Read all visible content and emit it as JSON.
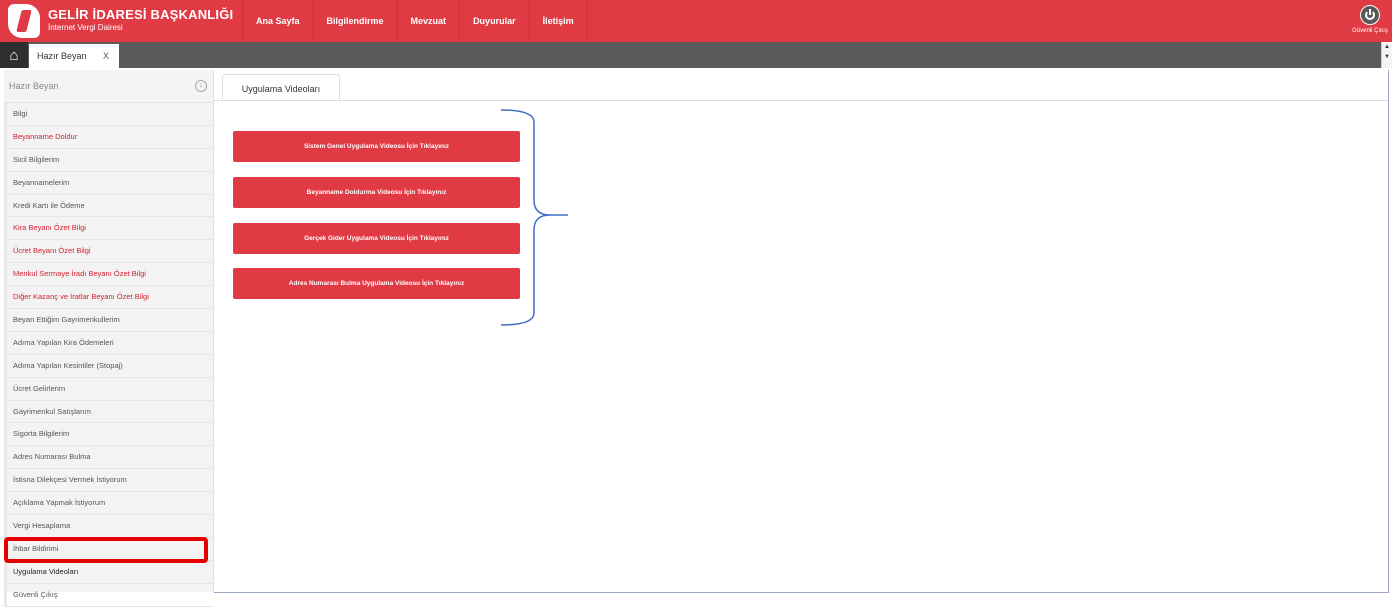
{
  "header": {
    "title": "GELİR İDARESİ BAŞKANLIĞI",
    "subtitle": "İnternet Vergi Dairesi",
    "nav": [
      "Ana Sayfa",
      "Bilgilendirme",
      "Mevzuat",
      "Duyurular",
      "İletişim"
    ],
    "logout_label": "Güvenli Çıkış"
  },
  "tabstrip": {
    "open_tab": "Hazır Beyan",
    "close_label": "X"
  },
  "sidebar": {
    "title": "Hazır Beyan",
    "items": [
      {
        "label": "Bilgi",
        "style": "normal"
      },
      {
        "label": "Beyanname Doldur",
        "style": "red"
      },
      {
        "label": "Sicil Bilgilerim",
        "style": "normal"
      },
      {
        "label": "Beyannamelerim",
        "style": "normal"
      },
      {
        "label": "Kredi Kartı ile Ödeme",
        "style": "normal"
      },
      {
        "label": "Kira Beyanı Özet Bilgi",
        "style": "red"
      },
      {
        "label": "Ücret Beyanı Özet Bilgi",
        "style": "red"
      },
      {
        "label": "Menkul Sermaye İradı Beyanı Özet Bilgi",
        "style": "red"
      },
      {
        "label": "Diğer Kazanç ve İratlar Beyanı Özet Bilgi",
        "style": "red"
      },
      {
        "label": "Beyan Ettiğim Gayrimenkullerim",
        "style": "normal"
      },
      {
        "label": "Adıma Yapılan Kira Ödemeleri",
        "style": "normal"
      },
      {
        "label": "Adıma Yapılan Kesintiler (Stopaj)",
        "style": "normal"
      },
      {
        "label": "Ücret Gelirlerim",
        "style": "normal"
      },
      {
        "label": "Gayrimenkul Satışlarım",
        "style": "normal"
      },
      {
        "label": "Sigorta Bilgilerim",
        "style": "normal"
      },
      {
        "label": "Adres Numarası Bulma",
        "style": "normal"
      },
      {
        "label": "İstisna Dilekçesi Vermek İstiyorum",
        "style": "normal"
      },
      {
        "label": "Açıklama Yapmak İstiyorum",
        "style": "normal"
      },
      {
        "label": "Vergi Hesaplama",
        "style": "normal"
      },
      {
        "label": "İhbar Bildirimi",
        "style": "normal"
      },
      {
        "label": "Uygulama Videoları",
        "style": "active"
      },
      {
        "label": "Güvenli Çıkış",
        "style": "normal"
      }
    ]
  },
  "main": {
    "tab_label": "Uygulama Videoları",
    "buttons": [
      "Sistem Genel Uygulama Videosu İçin Tıklayınız",
      "Beyanname Doldurma Videosu İçin Tıklayınız",
      "Gerçek Gider Uygulama Videosu İçin Tıklayınız",
      "Adres Numarası Bulma Uygulama Videosu İçin Tıklayınız"
    ]
  },
  "colors": {
    "brand_red": "#e03a44",
    "highlight": "#e60000",
    "brace": "#3f6ec4"
  }
}
